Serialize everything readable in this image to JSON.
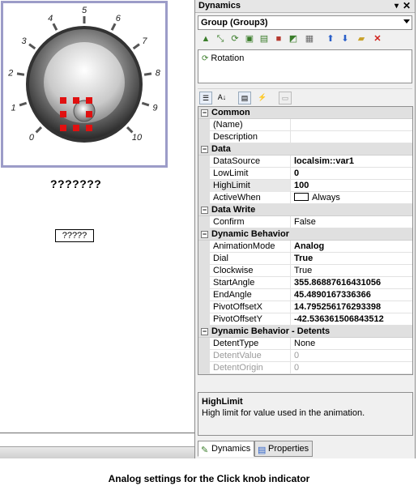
{
  "knob": {
    "ticks": [
      "0",
      "1",
      "2",
      "3",
      "4",
      "5",
      "6",
      "7",
      "8",
      "9",
      "10"
    ],
    "label": "???????",
    "value_box": "?????"
  },
  "panel": {
    "title": "Dynamics",
    "group": "Group (Group3)",
    "animation": "Rotation",
    "help_title": "HighLimit",
    "help_desc": "High limit for value used in the animation.",
    "tabs": [
      "Dynamics",
      "Properties"
    ]
  },
  "grid": [
    {
      "category": "Common",
      "rows": [
        {
          "name": "(Name)",
          "value": ""
        },
        {
          "name": "Description",
          "value": ""
        }
      ]
    },
    {
      "category": "Data",
      "rows": [
        {
          "name": "DataSource",
          "value": "localsim::var1",
          "bold": true
        },
        {
          "name": "LowLimit",
          "value": "0",
          "bold": true
        },
        {
          "name": "HighLimit",
          "value": "100",
          "bold": true,
          "selected": true
        },
        {
          "name": "ActiveWhen",
          "value": "Always",
          "colorbox": true
        }
      ]
    },
    {
      "category": "Data Write",
      "rows": [
        {
          "name": "Confirm",
          "value": "False"
        }
      ]
    },
    {
      "category": "Dynamic Behavior",
      "rows": [
        {
          "name": "AnimationMode",
          "value": "Analog",
          "bold": true
        },
        {
          "name": "Dial",
          "value": "True",
          "bold": true
        },
        {
          "name": "Clockwise",
          "value": "True"
        },
        {
          "name": "StartAngle",
          "value": "355.86887616431056",
          "bold": true
        },
        {
          "name": "EndAngle",
          "value": "45.4890167336366",
          "bold": true
        },
        {
          "name": "PivotOffsetX",
          "value": "14.795256176293398",
          "bold": true
        },
        {
          "name": "PivotOffsetY",
          "value": "-42.536361506843512",
          "bold": true
        }
      ]
    },
    {
      "category": "Dynamic Behavior - Detents",
      "rows": [
        {
          "name": "DetentType",
          "value": "None"
        },
        {
          "name": "DetentValue",
          "value": "0",
          "dim": true
        },
        {
          "name": "DetentOrigin",
          "value": "0",
          "dim": true
        }
      ]
    }
  ],
  "caption": "Analog settings for the Click knob indicator",
  "colors": {
    "frame": "#9c9cc8",
    "handle": "#e01010"
  }
}
